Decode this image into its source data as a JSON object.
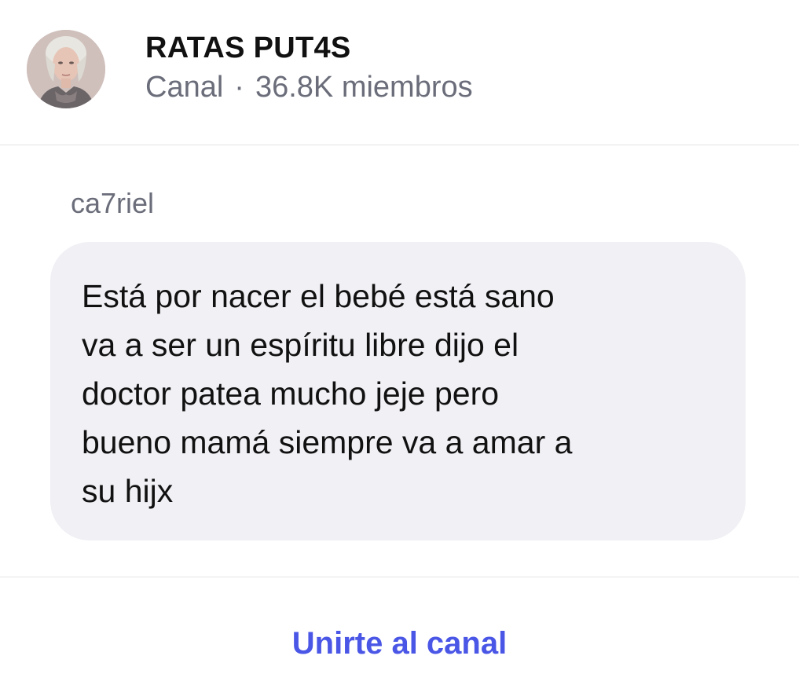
{
  "channel": {
    "name": "RATAS PUT4S",
    "type": "Canal",
    "separator": "·",
    "members": "36.8K miembros"
  },
  "message": {
    "sender": "ca7riel",
    "lines": [
      "Está por nacer el bebé está sano",
      "va a ser un espíritu libre dijo el",
      "doctor patea mucho jeje pero",
      "bueno mamá siempre va a amar a",
      "su hijx"
    ]
  },
  "actions": {
    "join_label": "Unirte al canal"
  },
  "colors": {
    "accent": "#4a56e6",
    "bubble": "#f0f0f5",
    "muted_text": "#6b6e7a"
  },
  "icons": {
    "avatar": "channel-avatar-photo"
  }
}
